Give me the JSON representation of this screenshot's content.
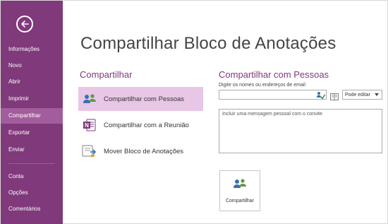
{
  "sidebar": {
    "back_icon": "back-arrow-icon",
    "items": [
      {
        "label": "Informações"
      },
      {
        "label": "Novo"
      },
      {
        "label": "Abrir"
      },
      {
        "label": "Imprimir"
      },
      {
        "label": "Compartilhar",
        "selected": true
      },
      {
        "label": "Exportar"
      },
      {
        "label": "Enviar"
      },
      {
        "label": "Conta"
      },
      {
        "label": "Opções"
      },
      {
        "label": "Comentários"
      }
    ]
  },
  "main": {
    "title": "Compartilhar Bloco de Anotações",
    "share_section": {
      "heading": "Compartilhar",
      "options": [
        {
          "label": "Compartilhar com Pessoas",
          "icon": "people-icon",
          "selected": true
        },
        {
          "label": "Compartilhar com a Reunião",
          "icon": "onenote-meeting-icon"
        },
        {
          "label": "Mover Bloco de Anotações",
          "icon": "move-notebook-icon"
        }
      ]
    },
    "people_section": {
      "heading": "Compartilhar com Pessoas",
      "names_label": "Digite os nomes ou endereços de email",
      "names_value": "",
      "permission": "Pode editar",
      "message_placeholder": "Incluir uma mensagem pessoal com o convite",
      "share_button_label": "Compartilhar"
    }
  },
  "colors": {
    "sidebar": "#80397b",
    "sidebar_selected": "#a25d9d",
    "accent": "#80397b",
    "option_selected": "#e8c6e6"
  }
}
